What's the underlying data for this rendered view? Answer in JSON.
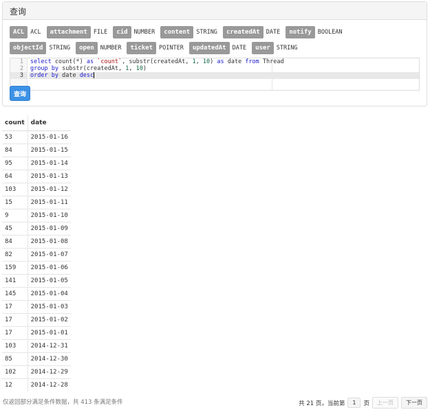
{
  "panel": {
    "title": "查询",
    "fields": [
      {
        "name": "ACL",
        "type": "ACL"
      },
      {
        "name": "attachment",
        "type": "FILE"
      },
      {
        "name": "cid",
        "type": "NUMBER"
      },
      {
        "name": "content",
        "type": "STRING"
      },
      {
        "name": "createdAt",
        "type": "DATE"
      },
      {
        "name": "notify",
        "type": "BOOLEAN"
      },
      {
        "name": "objectId",
        "type": "STRING"
      },
      {
        "name": "open",
        "type": "NUMBER"
      },
      {
        "name": "ticket",
        "type": "POINTER"
      },
      {
        "name": "updatedAt",
        "type": "DATE"
      },
      {
        "name": "user",
        "type": "STRING"
      }
    ],
    "editor": {
      "line_numbers": [
        "1",
        "2",
        "3"
      ],
      "lines": [
        "select count(*) as `count`, substr(createdAt, 1, 10) as date from Thread",
        "group by substr(createdAt, 1, 10)",
        "order by date desc"
      ]
    },
    "query_button": "查询"
  },
  "results": {
    "headers": [
      "count",
      "date"
    ],
    "rows": [
      [
        "53",
        "2015-01-16"
      ],
      [
        "84",
        "2015-01-15"
      ],
      [
        "95",
        "2015-01-14"
      ],
      [
        "64",
        "2015-01-13"
      ],
      [
        "103",
        "2015-01-12"
      ],
      [
        "15",
        "2015-01-11"
      ],
      [
        "9",
        "2015-01-10"
      ],
      [
        "45",
        "2015-01-09"
      ],
      [
        "84",
        "2015-01-08"
      ],
      [
        "82",
        "2015-01-07"
      ],
      [
        "159",
        "2015-01-06"
      ],
      [
        "141",
        "2015-01-05"
      ],
      [
        "145",
        "2015-01-04"
      ],
      [
        "17",
        "2015-01-03"
      ],
      [
        "17",
        "2015-01-02"
      ],
      [
        "17",
        "2015-01-01"
      ],
      [
        "103",
        "2014-12-31"
      ],
      [
        "85",
        "2014-12-30"
      ],
      [
        "102",
        "2014-12-29"
      ],
      [
        "12",
        "2014-12-28"
      ]
    ]
  },
  "footer": {
    "note": "仅返回部分满足条件数据，共 413 条满足条件",
    "pager_prefix": "共 21 页，当前第",
    "current_page": "1",
    "pager_suffix": "页",
    "prev": "上一页",
    "next": "下一页"
  }
}
